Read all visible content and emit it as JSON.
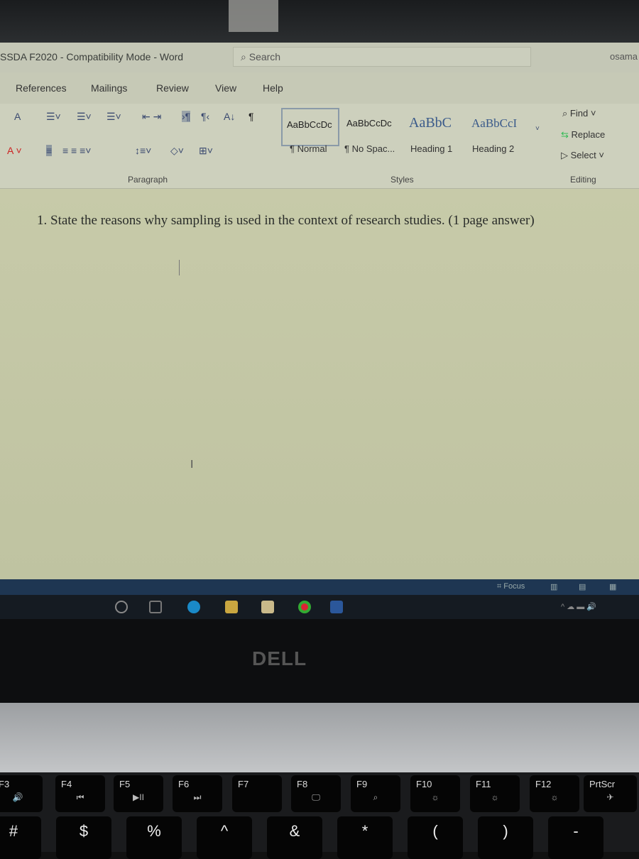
{
  "window": {
    "title": "SSDA F2020  -  Compatibility Mode  -  Word",
    "search_placeholder": "Search",
    "user": "osama"
  },
  "tabs": [
    "References",
    "Mailings",
    "Review",
    "View",
    "Help"
  ],
  "ribbon": {
    "paragraph_group": "Paragraph",
    "styles_group": "Styles",
    "editing_group": "Editing",
    "styles": [
      {
        "preview": "AaBbCcDc",
        "name": "¶ Normal",
        "selected": true
      },
      {
        "preview": "AaBbCcDc",
        "name": "¶ No Spac..."
      },
      {
        "preview": "AaBbC",
        "name": "Heading 1"
      },
      {
        "preview": "AaBbCcI",
        "name": "Heading 2"
      }
    ],
    "editing": {
      "find": "Find",
      "replace": "Replace",
      "select": "Select"
    }
  },
  "document": {
    "question": "1.  State the reasons why sampling is used in the context of research studies. (1 page answer)"
  },
  "statusbar": {
    "focus": "Focus"
  },
  "laptop": {
    "brand": "DELL"
  },
  "keyboard": {
    "fn_keys": [
      [
        "F3",
        "🔊"
      ],
      [
        "F4",
        "⏮"
      ],
      [
        "F5",
        "▶II"
      ],
      [
        "F6",
        "⏭"
      ],
      [
        "F7",
        ""
      ],
      [
        "F8",
        "🖵"
      ],
      [
        "F9",
        "⌕"
      ],
      [
        "F10",
        "☼"
      ],
      [
        "F11",
        "☼"
      ],
      [
        "F12",
        "☼"
      ],
      [
        "PrtScr",
        "✈"
      ]
    ],
    "number_row": [
      "#",
      "$",
      "%",
      "^",
      "&",
      "*",
      "(",
      ")",
      "-"
    ]
  },
  "colors": {
    "document_bg": "#c5c9a7",
    "statusbar": "#1e3652",
    "ribbon": "#cdd0bd"
  }
}
